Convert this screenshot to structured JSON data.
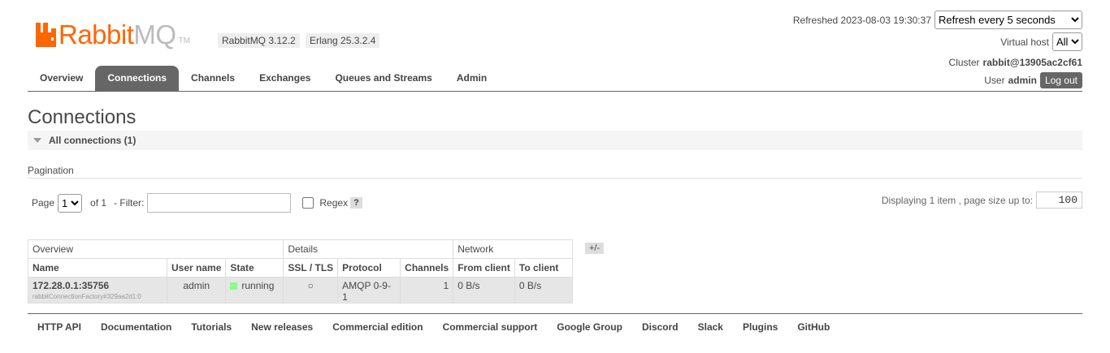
{
  "brand": {
    "name_part1": "Rabbit",
    "name_part2": "MQ",
    "tm": "TM"
  },
  "versions": {
    "rabbitmq": "RabbitMQ 3.12.2",
    "erlang": "Erlang 25.3.2.4"
  },
  "nav": {
    "tabs": [
      "Overview",
      "Connections",
      "Channels",
      "Exchanges",
      "Queues and Streams",
      "Admin"
    ],
    "active": "Connections"
  },
  "header_right": {
    "refreshed_label": "Refreshed 2023-08-03 19:30:37",
    "refresh_option": "Refresh every 5 seconds",
    "virtual_host_label": "Virtual host",
    "virtual_host_value": "All",
    "cluster_label": "Cluster",
    "cluster_value": "rabbit@13905ac2cf61",
    "user_label": "User",
    "user_value": "admin",
    "logout_label": "Log out"
  },
  "page": {
    "title": "Connections",
    "section_title": "All connections (1)"
  },
  "pagination": {
    "label": "Pagination",
    "page_label": "Page",
    "page_value": "1",
    "of_label": "of 1",
    "filter_label": "- Filter:",
    "filter_value": "",
    "regex_label": "Regex",
    "help_label": "?",
    "display_label": "Displaying 1 item , page size up to:",
    "page_size": "100"
  },
  "table": {
    "groups": [
      "Overview",
      "Details",
      "Network"
    ],
    "columns": [
      "Name",
      "User name",
      "State",
      "SSL / TLS",
      "Protocol",
      "Channels",
      "From client",
      "To client"
    ],
    "rows": [
      {
        "name": "172.28.0.1:35756",
        "client_name": "rabbitConnectionFactory#329aa2d1:0",
        "user": "admin",
        "state": "running",
        "ssl": "○",
        "protocol": "AMQP 0-9-1",
        "channels": "1",
        "from_client": "0 B/s",
        "to_client": "0 B/s"
      }
    ],
    "toggle_label": "+/-"
  },
  "footer": {
    "links": [
      "HTTP API",
      "Documentation",
      "Tutorials",
      "New releases",
      "Commercial edition",
      "Commercial support",
      "Google Group",
      "Discord",
      "Slack",
      "Plugins",
      "GitHub"
    ]
  },
  "colors": {
    "brand_orange": "#ff6600",
    "tab_active": "#666666",
    "running": "#88ff88"
  }
}
